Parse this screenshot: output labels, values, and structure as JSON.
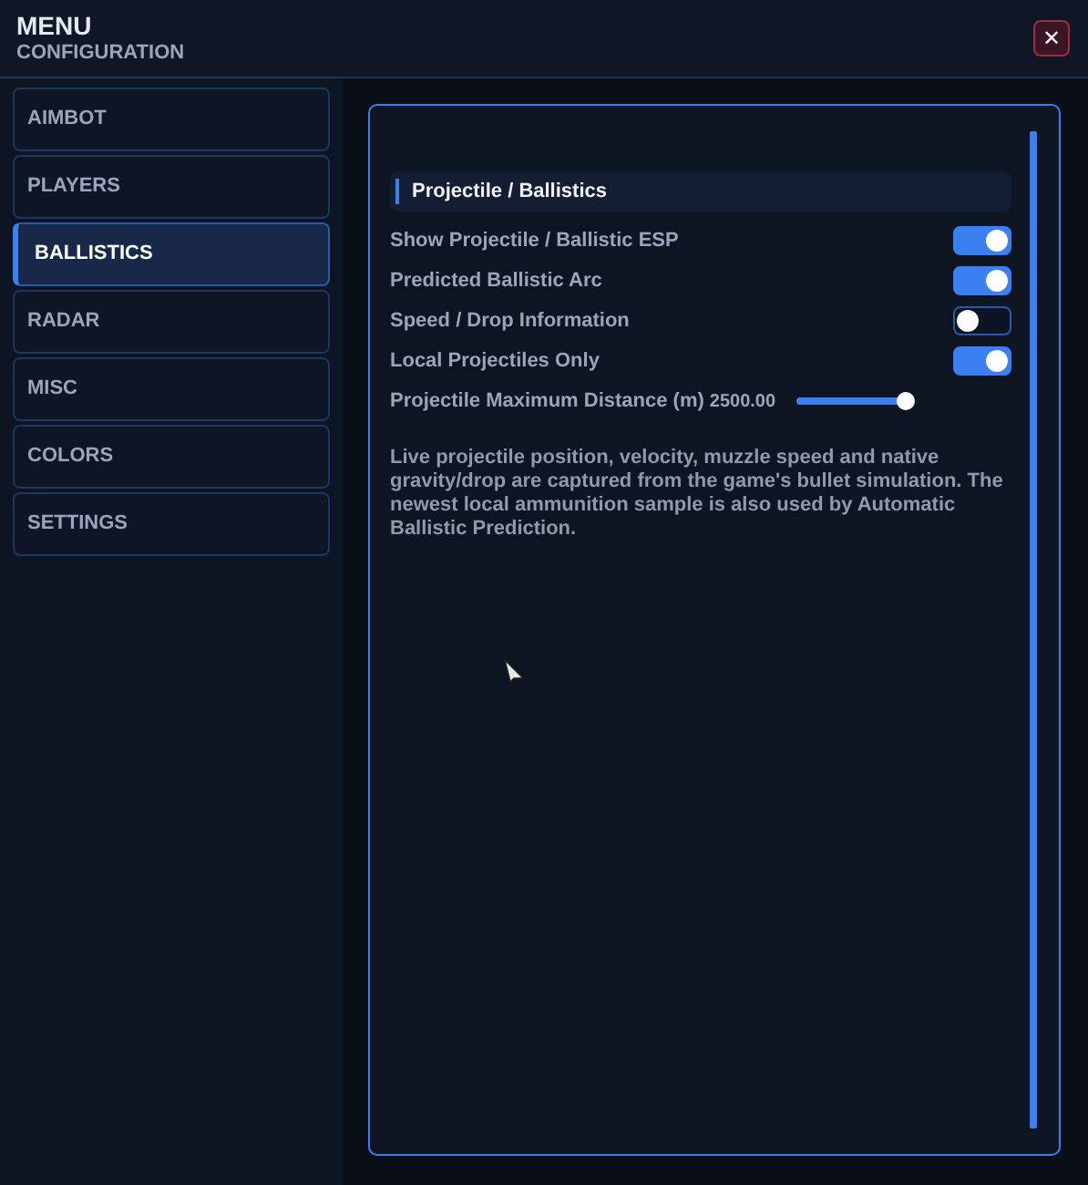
{
  "header": {
    "title": "MENU",
    "subtitle": "CONFIGURATION",
    "close": "✕"
  },
  "sidebar": {
    "items": [
      {
        "label": "AIMBOT",
        "selected": false
      },
      {
        "label": "PLAYERS",
        "selected": false
      },
      {
        "label": "BALLISTICS",
        "selected": true
      },
      {
        "label": "RADAR",
        "selected": false
      },
      {
        "label": "MISC",
        "selected": false
      },
      {
        "label": "COLORS",
        "selected": false
      },
      {
        "label": "SETTINGS",
        "selected": false
      }
    ]
  },
  "panel": {
    "section_title": "Projectile / Ballistics",
    "settings": [
      {
        "kind": "toggle",
        "label": "Show Projectile / Ballistic ESP",
        "on": true
      },
      {
        "kind": "toggle",
        "label": "Predicted Ballistic Arc",
        "on": true
      },
      {
        "kind": "toggle",
        "label": "Speed / Drop Information",
        "on": false
      },
      {
        "kind": "toggle",
        "label": "Local Projectiles Only",
        "on": true
      },
      {
        "kind": "slider",
        "label": "Projectile Maximum Distance (m)",
        "reading": "2500.00",
        "level": 1
      }
    ],
    "description": "Live projectile position, velocity, muzzle speed and native gravity/drop are captured from the game's bullet simulation. The newest local ammunition sample is also used by Automatic Ballistic Prediction."
  }
}
